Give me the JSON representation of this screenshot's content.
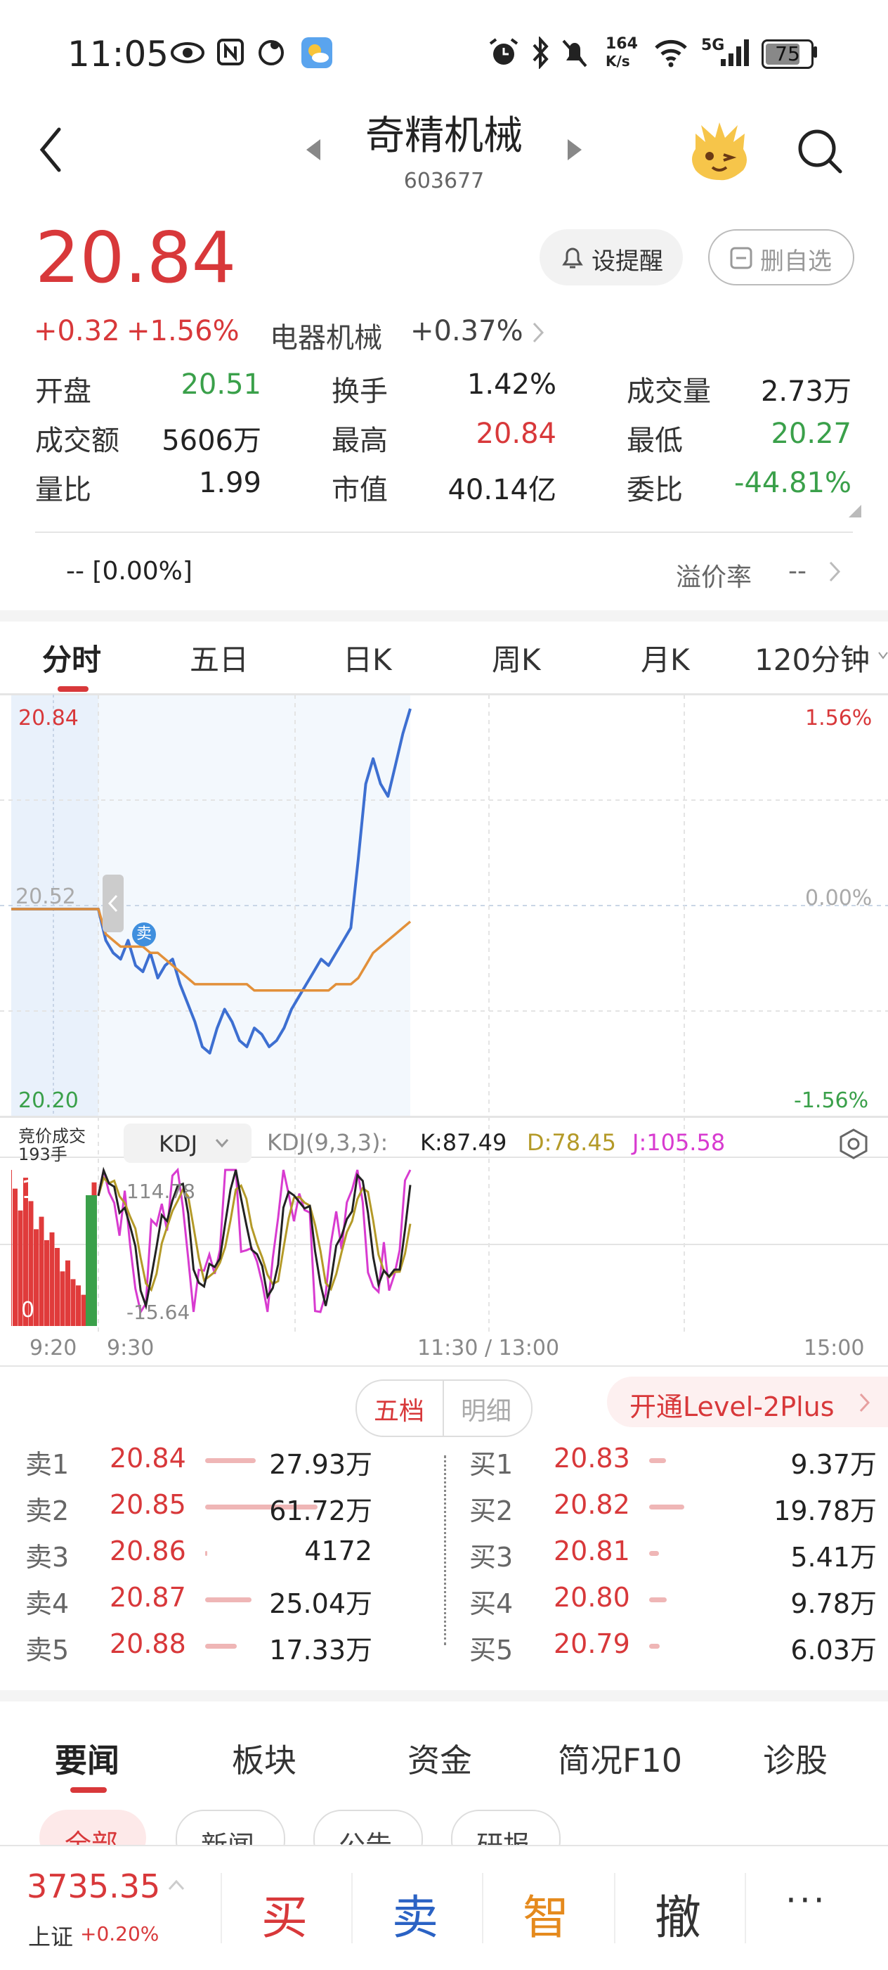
{
  "status": {
    "time": "11:05",
    "net_speed_top": "164",
    "net_speed_bottom": "K/s",
    "network": "5G",
    "battery": "75"
  },
  "header": {
    "name": "奇精机械",
    "code": "603677"
  },
  "quote": {
    "price": "20.84",
    "change": "+0.32",
    "change_pct": "+1.56%",
    "sector": "电器机械",
    "sector_pct": "+0.37%",
    "remind_label": "设提醒",
    "remove_label": "删自选"
  },
  "stats": [
    {
      "label": "开盘",
      "value": "20.51",
      "color": "green"
    },
    {
      "label": "换手",
      "value": "1.42%",
      "color": "black"
    },
    {
      "label": "成交量",
      "value": "2.73万",
      "color": "black"
    },
    {
      "label": "成交额",
      "value": "5606万",
      "color": "black"
    },
    {
      "label": "最高",
      "value": "20.84",
      "color": "red"
    },
    {
      "label": "最低",
      "value": "20.27",
      "color": "green"
    },
    {
      "label": "量比",
      "value": "1.99",
      "color": "black"
    },
    {
      "label": "市值",
      "value": "40.14亿",
      "color": "black"
    },
    {
      "label": "委比",
      "value": "-44.81%",
      "color": "green"
    }
  ],
  "premium": {
    "left": "-- [0.00%]",
    "label": "溢价率",
    "value": "--"
  },
  "chart_tabs": [
    "分时",
    "五日",
    "日K",
    "周K",
    "月K",
    "120分钟"
  ],
  "chart": {
    "price_high": "20.84",
    "price_mid": "20.52",
    "price_low": "20.20",
    "pct_high": "1.56%",
    "pct_mid": "0.00%",
    "pct_low": "-1.56%",
    "sell_marker": "卖",
    "auction_label": "竞价成交",
    "auction_volume": "193手",
    "indicator": "KDJ",
    "indicator_params": "KDJ(9,3,3):",
    "k_label": "K:87.49",
    "d_label": "D:78.45",
    "j_label": "J:105.58",
    "kdj_high": "114.78",
    "kdj_low": "-15.64",
    "vol_high": "193",
    "vol_low": "0",
    "time_start": "9:20",
    "time_open": "9:30",
    "time_mid": "11:30 / 13:00",
    "time_end": "15:00"
  },
  "chart_data": {
    "type": "line",
    "title": "",
    "ylim": [
      20.2,
      20.84
    ],
    "x_range": [
      "9:20",
      "15:00"
    ],
    "series": [
      {
        "name": "",
        "color": "#3d6fd1",
        "values": [
          20.52,
          20.52,
          20.52,
          20.47,
          20.45,
          20.44,
          20.47,
          20.43,
          20.42,
          20.45,
          20.41,
          20.43,
          20.44,
          20.4,
          20.37,
          20.34,
          20.3,
          20.29,
          20.33,
          20.36,
          20.34,
          20.31,
          20.3,
          20.33,
          20.32,
          20.3,
          20.31,
          20.33,
          20.36,
          20.38,
          20.4,
          20.42,
          20.44,
          20.43,
          20.45,
          20.47,
          20.49,
          20.6,
          20.72,
          20.76,
          20.72,
          20.7,
          20.75,
          20.8,
          20.84
        ]
      },
      {
        "name": "",
        "color": "#e2903a",
        "values": [
          20.52,
          20.52,
          20.52,
          20.48,
          20.47,
          20.46,
          20.46,
          20.46,
          20.46,
          20.45,
          20.45,
          20.44,
          20.43,
          20.42,
          20.41,
          20.4,
          20.4,
          20.4,
          20.4,
          20.4,
          20.4,
          20.4,
          20.4,
          20.39,
          20.39,
          20.39,
          20.39,
          20.39,
          20.39,
          20.39,
          20.39,
          20.39,
          20.39,
          20.39,
          20.4,
          20.4,
          20.4,
          20.41,
          20.43,
          20.45,
          20.46,
          20.47,
          20.48,
          20.49,
          20.5
        ]
      }
    ]
  },
  "orderbook": {
    "tab_active": "五档",
    "tab_inactive": "明细",
    "level2": "开通Level-2Plus",
    "sell": [
      {
        "label": "卖1",
        "price": "20.84",
        "volume": "27.93万",
        "bar": 0.45
      },
      {
        "label": "卖2",
        "price": "20.85",
        "volume": "61.72万",
        "bar": 1.0
      },
      {
        "label": "卖3",
        "price": "20.86",
        "volume": "4172",
        "bar": 0.02
      },
      {
        "label": "卖4",
        "price": "20.87",
        "volume": "25.04万",
        "bar": 0.41
      },
      {
        "label": "卖5",
        "price": "20.88",
        "volume": "17.33万",
        "bar": 0.28
      }
    ],
    "buy": [
      {
        "label": "买1",
        "price": "20.83",
        "volume": "9.37万",
        "bar": 0.47
      },
      {
        "label": "买2",
        "price": "20.82",
        "volume": "19.78万",
        "bar": 1.0
      },
      {
        "label": "买3",
        "price": "20.81",
        "volume": "5.41万",
        "bar": 0.27
      },
      {
        "label": "买4",
        "price": "20.80",
        "volume": "9.78万",
        "bar": 0.49
      },
      {
        "label": "买5",
        "price": "20.79",
        "volume": "6.03万",
        "bar": 0.3
      }
    ]
  },
  "news_tabs": [
    "要闻",
    "板块",
    "资金",
    "简况F10",
    "诊股"
  ],
  "sub_tabs": [
    "全部",
    "新闻",
    "公告",
    "研报"
  ],
  "bottom": {
    "index_value": "3735.35",
    "index_name": "上证",
    "index_pct": "+0.20%",
    "buy": "买",
    "sell": "卖",
    "smart": "智",
    "cancel": "撤",
    "more": "···"
  }
}
